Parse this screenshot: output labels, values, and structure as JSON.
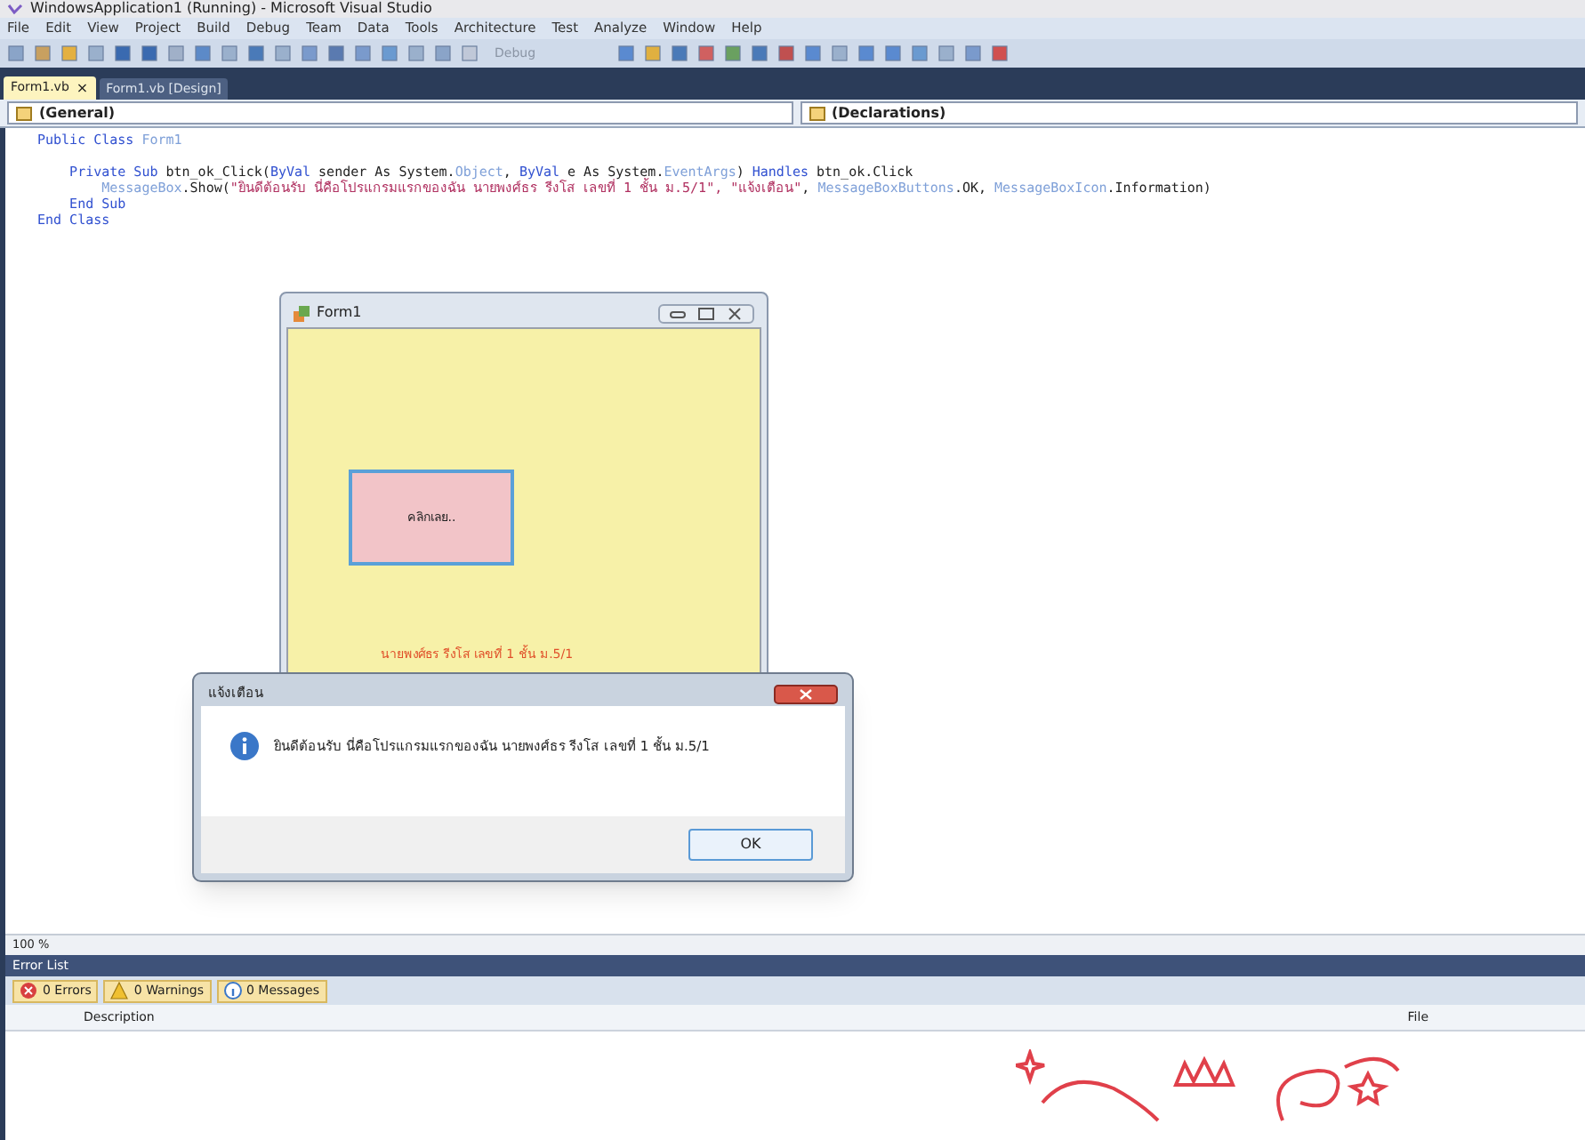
{
  "window": {
    "title": "WindowsApplication1 (Running) - Microsoft Visual Studio"
  },
  "menu": [
    "File",
    "Edit",
    "View",
    "Project",
    "Build",
    "Debug",
    "Team",
    "Data",
    "Tools",
    "Architecture",
    "Test",
    "Analyze",
    "Window",
    "Help"
  ],
  "toolbar": {
    "config": "Debug"
  },
  "tabs": [
    {
      "label": "Form1.vb",
      "selected": true,
      "close": "×"
    },
    {
      "label": "Form1.vb [Design]",
      "selected": false
    }
  ],
  "code_bar": {
    "left": "(General)",
    "right": "(Declarations)"
  },
  "code": [
    [
      {
        "kind": "keyword",
        "text": "Public Class "
      },
      {
        "kind": "type",
        "text": "Form1"
      }
    ],
    [
      {
        "kind": "keyword",
        "text": "    Private Sub "
      },
      {
        "kind": "plain",
        "text": "btn_ok_Click("
      },
      {
        "kind": "keyword",
        "text": "ByVal"
      },
      {
        "kind": "plain",
        "text": " sender As System."
      },
      {
        "kind": "type",
        "text": "Object"
      },
      {
        "kind": "plain",
        "text": ", "
      },
      {
        "kind": "keyword",
        "text": "ByVal"
      },
      {
        "kind": "plain",
        "text": " e As System."
      },
      {
        "kind": "type",
        "text": "EventArgs"
      },
      {
        "kind": "plain",
        "text": ") "
      },
      {
        "kind": "keyword",
        "text": "Handles"
      },
      {
        "kind": "plain",
        "text": " btn_ok.Click"
      }
    ],
    [
      {
        "kind": "type",
        "text": "        MessageBox"
      },
      {
        "kind": "plain",
        "text": ".Show("
      },
      {
        "kind": "string",
        "text": "\"ยินดีต้อนรับ นี่คือโปรแกรมแรกของฉัน นายพงศ์ธร รีงโส เลขที่ 1 ชั้น ม.5/1\", \"แจ้งเตือน\""
      },
      {
        "kind": "plain",
        "text": ", "
      },
      {
        "kind": "type",
        "text": "MessageBoxButtons"
      },
      {
        "kind": "plain",
        "text": ".OK, "
      },
      {
        "kind": "type",
        "text": "MessageBoxIcon"
      },
      {
        "kind": "plain",
        "text": ".Information)"
      }
    ],
    [
      {
        "kind": "keyword",
        "text": "    End Sub"
      }
    ],
    [
      {
        "kind": "keyword",
        "text": "End Class"
      }
    ]
  ],
  "form": {
    "title": "Form1",
    "button": "คลิกเลย..",
    "label": "นายพงศ์ธร รีงโส เลขที่ 1 ชั้น ม.5/1"
  },
  "dialog": {
    "title": "แจ้งเตือน",
    "message": "ยินดีต้อนรับ นี่คือโปรแกรมแรกของฉัน นายพงศ์ธร รีงโส เลขที่ 1 ชั้น ม.5/1",
    "button": "OK"
  },
  "zoom": "100 %",
  "error_list": {
    "title": "Error List",
    "filters": [
      {
        "kind": "error",
        "label": "0 Errors"
      },
      {
        "kind": "warning",
        "label": "0 Warnings"
      },
      {
        "kind": "message",
        "label": "0 Messages"
      }
    ],
    "columns": [
      "Description",
      "File"
    ]
  }
}
